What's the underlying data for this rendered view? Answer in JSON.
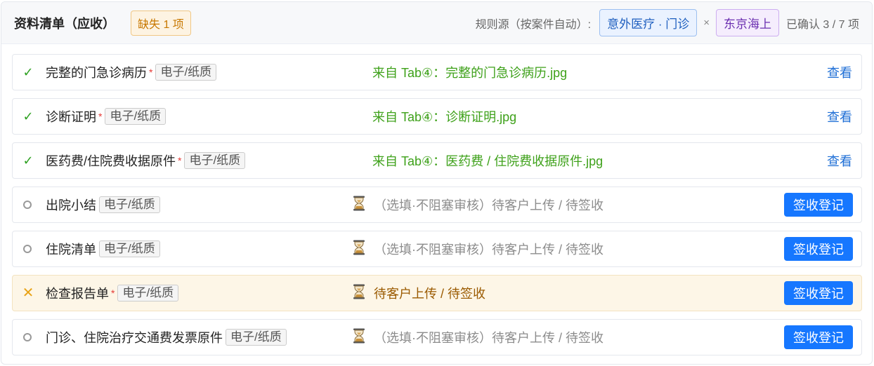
{
  "header": {
    "title": "资料清单（应收）",
    "missing_badge": "缺失 1 项",
    "rule_label": "规则源（按案件自动）:",
    "tag_category": "意外医疗 · 门诊",
    "tag_separator": "×",
    "tag_insurer": "东京海上",
    "confirmed": "已确认 3 / 7 项"
  },
  "colors": {
    "accent": "#1677ff",
    "success": "#2ea121",
    "warning": "#e8a317",
    "required": "#e53935"
  },
  "rows": [
    {
      "status": "check",
      "name": "完整的门急诊病历",
      "required": "*",
      "format": "电子/纸质",
      "source": "来自 Tab④：完整的门急诊病历.jpg",
      "action": "查看"
    },
    {
      "status": "check",
      "name": "诊断证明",
      "required": "*",
      "format": "电子/纸质",
      "source": "来自 Tab④：诊断证明.jpg",
      "action": "查看"
    },
    {
      "status": "check",
      "name": "医药费/住院费收据原件",
      "required": "*",
      "format": "电子/纸质",
      "source": "来自 Tab④：医药费 / 住院费收据原件.jpg",
      "action": "查看"
    },
    {
      "status": "optional",
      "name": "出院小结",
      "format": "电子/纸质",
      "pending": "（选填·不阻塞审核）待客户上传 / 待签收",
      "action": "签收登记"
    },
    {
      "status": "optional",
      "name": "住院清单",
      "format": "电子/纸质",
      "pending": "（选填·不阻塞审核）待客户上传 / 待签收",
      "action": "签收登记"
    },
    {
      "status": "missing",
      "name": "检查报告单",
      "required": "*",
      "format": "电子/纸质",
      "pending": "待客户上传 / 待签收",
      "action": "签收登记"
    },
    {
      "status": "optional",
      "name": "门诊、住院治疗交通费发票原件",
      "format": "电子/纸质",
      "pending": "（选填·不阻塞审核）待客户上传 / 待签收",
      "action": "签收登记"
    }
  ],
  "icons": {
    "check": "check-icon",
    "optional": "circle-icon",
    "missing": "close-icon",
    "pending": "hourglass-icon"
  }
}
